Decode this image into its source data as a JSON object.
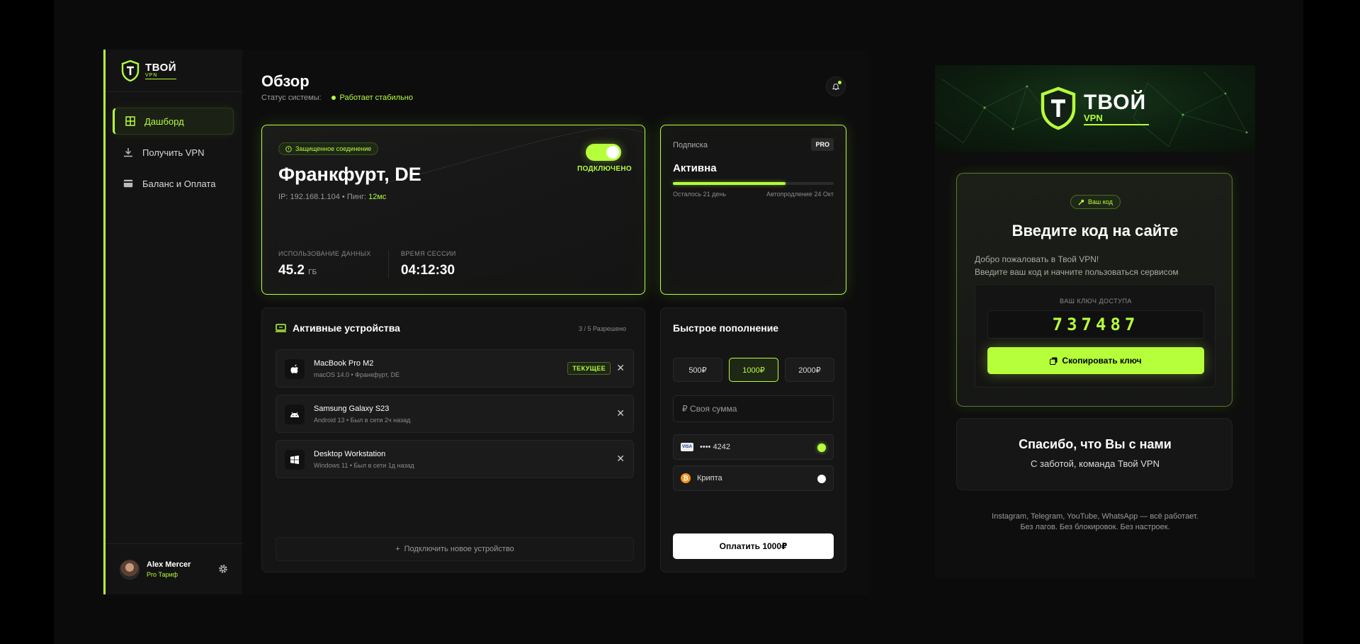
{
  "brand": {
    "name": "ТВОЙ",
    "sub": "VPN"
  },
  "sidebar": {
    "items": [
      {
        "label": "Дашборд",
        "icon": "grid-icon",
        "active": true
      },
      {
        "label": "Получить VPN",
        "icon": "download-icon",
        "active": false
      },
      {
        "label": "Баланс и Оплата",
        "icon": "card-icon",
        "active": false
      }
    ],
    "user": {
      "name": "Alex Mercer",
      "plan": "Pro Тариф"
    }
  },
  "header": {
    "title": "Обзор",
    "status_label": "Статус системы:",
    "status_value": "Работает стабильно"
  },
  "connection": {
    "badge": "Защищенное соединение",
    "city": "Франкфурт, DE",
    "ip_text": "IP: 192.168.1.104  •  Пинг: ",
    "ping": "12мс",
    "state": "ПОДКЛЮЧЕНО",
    "data_label": "ИСПОЛЬЗОВАНИЕ ДАННЫХ",
    "data_value": "45.2",
    "data_unit": "ГБ",
    "session_label": "ВРЕМЯ СЕССИИ",
    "session_value": "04:12:30"
  },
  "subscription": {
    "label": "Подписка",
    "tier": "PRO",
    "status": "Активна",
    "progress": 0.7,
    "left": "Осталось 21 день",
    "renew": "Автопродление 24 Окт"
  },
  "devices": {
    "title": "Активные устройства",
    "count": "3 / 5 Разрешено",
    "current_label": "ТЕКУЩЕЕ",
    "items": [
      {
        "name": "MacBook Pro M2",
        "meta": "macOS 14.0 • Франкфурт, DE",
        "icon": "apple-icon",
        "current": true
      },
      {
        "name": "Samsung Galaxy S23",
        "meta": "Android 13 • Был в сети 2ч назад",
        "icon": "android-icon",
        "current": false
      },
      {
        "name": "Desktop Workstation",
        "meta": "Windows 11 • Был в сети 1д назад",
        "icon": "windows-icon",
        "current": false
      }
    ],
    "add_label": "Подключить новое устройство"
  },
  "topup": {
    "title": "Быстрое пополнение",
    "amounts": [
      "500₽",
      "1000₽",
      "2000₽"
    ],
    "selected": 1,
    "custom_placeholder": "₽ Своя сумма",
    "methods": [
      {
        "label": "•••• 4242",
        "icon": "visa-icon",
        "selected": true
      },
      {
        "label": "Крипта",
        "icon": "bitcoin-icon",
        "selected": false
      }
    ],
    "pay_label": "Оплатить 1000₽",
    "visa_text": "VISA",
    "btc_text": "₿"
  },
  "promo": {
    "brand_name": "ТВОЙ",
    "brand_sub": "VPN",
    "code_badge": "Ваш код",
    "code_title": "Введите код на сайте",
    "welcome1": "Добро пожаловать в Твой VPN!",
    "welcome2": "Введите ваш код и начните пользоваться сервисом",
    "key_label": "ВАШ КЛЮЧ ДОСТУПА",
    "key_value": "737487",
    "copy_label": "Скопировать ключ",
    "thanks_title": "Спасибо, что Вы с нами",
    "thanks_sub": "С заботой, команда Твой VPN",
    "footer1": "Instagram, Telegram, YouTube, WhatsApp — всё работает.",
    "footer2": "Без лагов. Без блокировок. Без настроек."
  },
  "colors": {
    "accent": "#b6ff3b",
    "background": "#0b0b0b",
    "card": "#151515"
  }
}
